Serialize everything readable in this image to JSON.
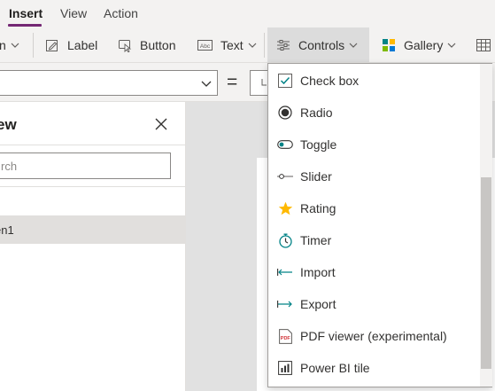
{
  "menu": {
    "tabs": [
      {
        "label": "Insert",
        "active": true
      },
      {
        "label": "View",
        "active": false
      },
      {
        "label": "Action",
        "active": false
      }
    ]
  },
  "ribbon": {
    "partial_label": "n",
    "label_button": "Label",
    "button_button": "Button",
    "text_button": "Text",
    "controls_button": "Controls",
    "gallery_button": "Gallery"
  },
  "formula": {
    "equals": "="
  },
  "treeview": {
    "title": "ew",
    "search_placeholder": "rch",
    "items": [
      {
        "label": "en1"
      }
    ]
  },
  "controls_menu": {
    "items": [
      {
        "label": "Check box",
        "icon": "checkbox-icon"
      },
      {
        "label": "Radio",
        "icon": "radio-icon"
      },
      {
        "label": "Toggle",
        "icon": "toggle-icon"
      },
      {
        "label": "Slider",
        "icon": "slider-icon"
      },
      {
        "label": "Rating",
        "icon": "star-icon"
      },
      {
        "label": "Timer",
        "icon": "timer-icon"
      },
      {
        "label": "Import",
        "icon": "import-arrow-icon"
      },
      {
        "label": "Export",
        "icon": "export-arrow-icon"
      },
      {
        "label": "PDF viewer (experimental)",
        "icon": "pdf-icon"
      },
      {
        "label": "Power BI tile",
        "icon": "powerbi-icon"
      }
    ]
  },
  "colors": {
    "accent": "#742774",
    "teal": "#038387",
    "star": "#ffb900"
  }
}
